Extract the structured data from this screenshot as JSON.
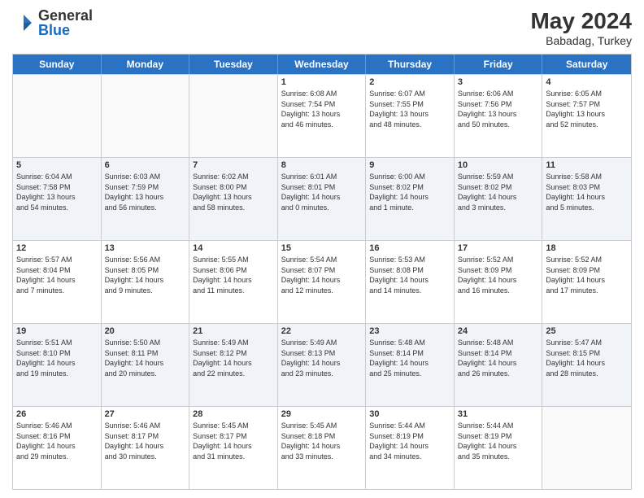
{
  "header": {
    "logo": {
      "general": "General",
      "blue": "Blue"
    },
    "title": "May 2024",
    "location": "Babadag, Turkey"
  },
  "weekdays": [
    "Sunday",
    "Monday",
    "Tuesday",
    "Wednesday",
    "Thursday",
    "Friday",
    "Saturday"
  ],
  "rows": [
    [
      {
        "day": "",
        "info": ""
      },
      {
        "day": "",
        "info": ""
      },
      {
        "day": "",
        "info": ""
      },
      {
        "day": "1",
        "info": "Sunrise: 6:08 AM\nSunset: 7:54 PM\nDaylight: 13 hours\nand 46 minutes."
      },
      {
        "day": "2",
        "info": "Sunrise: 6:07 AM\nSunset: 7:55 PM\nDaylight: 13 hours\nand 48 minutes."
      },
      {
        "day": "3",
        "info": "Sunrise: 6:06 AM\nSunset: 7:56 PM\nDaylight: 13 hours\nand 50 minutes."
      },
      {
        "day": "4",
        "info": "Sunrise: 6:05 AM\nSunset: 7:57 PM\nDaylight: 13 hours\nand 52 minutes."
      }
    ],
    [
      {
        "day": "5",
        "info": "Sunrise: 6:04 AM\nSunset: 7:58 PM\nDaylight: 13 hours\nand 54 minutes."
      },
      {
        "day": "6",
        "info": "Sunrise: 6:03 AM\nSunset: 7:59 PM\nDaylight: 13 hours\nand 56 minutes."
      },
      {
        "day": "7",
        "info": "Sunrise: 6:02 AM\nSunset: 8:00 PM\nDaylight: 13 hours\nand 58 minutes."
      },
      {
        "day": "8",
        "info": "Sunrise: 6:01 AM\nSunset: 8:01 PM\nDaylight: 14 hours\nand 0 minutes."
      },
      {
        "day": "9",
        "info": "Sunrise: 6:00 AM\nSunset: 8:02 PM\nDaylight: 14 hours\nand 1 minute."
      },
      {
        "day": "10",
        "info": "Sunrise: 5:59 AM\nSunset: 8:02 PM\nDaylight: 14 hours\nand 3 minutes."
      },
      {
        "day": "11",
        "info": "Sunrise: 5:58 AM\nSunset: 8:03 PM\nDaylight: 14 hours\nand 5 minutes."
      }
    ],
    [
      {
        "day": "12",
        "info": "Sunrise: 5:57 AM\nSunset: 8:04 PM\nDaylight: 14 hours\nand 7 minutes."
      },
      {
        "day": "13",
        "info": "Sunrise: 5:56 AM\nSunset: 8:05 PM\nDaylight: 14 hours\nand 9 minutes."
      },
      {
        "day": "14",
        "info": "Sunrise: 5:55 AM\nSunset: 8:06 PM\nDaylight: 14 hours\nand 11 minutes."
      },
      {
        "day": "15",
        "info": "Sunrise: 5:54 AM\nSunset: 8:07 PM\nDaylight: 14 hours\nand 12 minutes."
      },
      {
        "day": "16",
        "info": "Sunrise: 5:53 AM\nSunset: 8:08 PM\nDaylight: 14 hours\nand 14 minutes."
      },
      {
        "day": "17",
        "info": "Sunrise: 5:52 AM\nSunset: 8:09 PM\nDaylight: 14 hours\nand 16 minutes."
      },
      {
        "day": "18",
        "info": "Sunrise: 5:52 AM\nSunset: 8:09 PM\nDaylight: 14 hours\nand 17 minutes."
      }
    ],
    [
      {
        "day": "19",
        "info": "Sunrise: 5:51 AM\nSunset: 8:10 PM\nDaylight: 14 hours\nand 19 minutes."
      },
      {
        "day": "20",
        "info": "Sunrise: 5:50 AM\nSunset: 8:11 PM\nDaylight: 14 hours\nand 20 minutes."
      },
      {
        "day": "21",
        "info": "Sunrise: 5:49 AM\nSunset: 8:12 PM\nDaylight: 14 hours\nand 22 minutes."
      },
      {
        "day": "22",
        "info": "Sunrise: 5:49 AM\nSunset: 8:13 PM\nDaylight: 14 hours\nand 23 minutes."
      },
      {
        "day": "23",
        "info": "Sunrise: 5:48 AM\nSunset: 8:14 PM\nDaylight: 14 hours\nand 25 minutes."
      },
      {
        "day": "24",
        "info": "Sunrise: 5:48 AM\nSunset: 8:14 PM\nDaylight: 14 hours\nand 26 minutes."
      },
      {
        "day": "25",
        "info": "Sunrise: 5:47 AM\nSunset: 8:15 PM\nDaylight: 14 hours\nand 28 minutes."
      }
    ],
    [
      {
        "day": "26",
        "info": "Sunrise: 5:46 AM\nSunset: 8:16 PM\nDaylight: 14 hours\nand 29 minutes."
      },
      {
        "day": "27",
        "info": "Sunrise: 5:46 AM\nSunset: 8:17 PM\nDaylight: 14 hours\nand 30 minutes."
      },
      {
        "day": "28",
        "info": "Sunrise: 5:45 AM\nSunset: 8:17 PM\nDaylight: 14 hours\nand 31 minutes."
      },
      {
        "day": "29",
        "info": "Sunrise: 5:45 AM\nSunset: 8:18 PM\nDaylight: 14 hours\nand 33 minutes."
      },
      {
        "day": "30",
        "info": "Sunrise: 5:44 AM\nSunset: 8:19 PM\nDaylight: 14 hours\nand 34 minutes."
      },
      {
        "day": "31",
        "info": "Sunrise: 5:44 AM\nSunset: 8:19 PM\nDaylight: 14 hours\nand 35 minutes."
      },
      {
        "day": "",
        "info": ""
      }
    ]
  ]
}
